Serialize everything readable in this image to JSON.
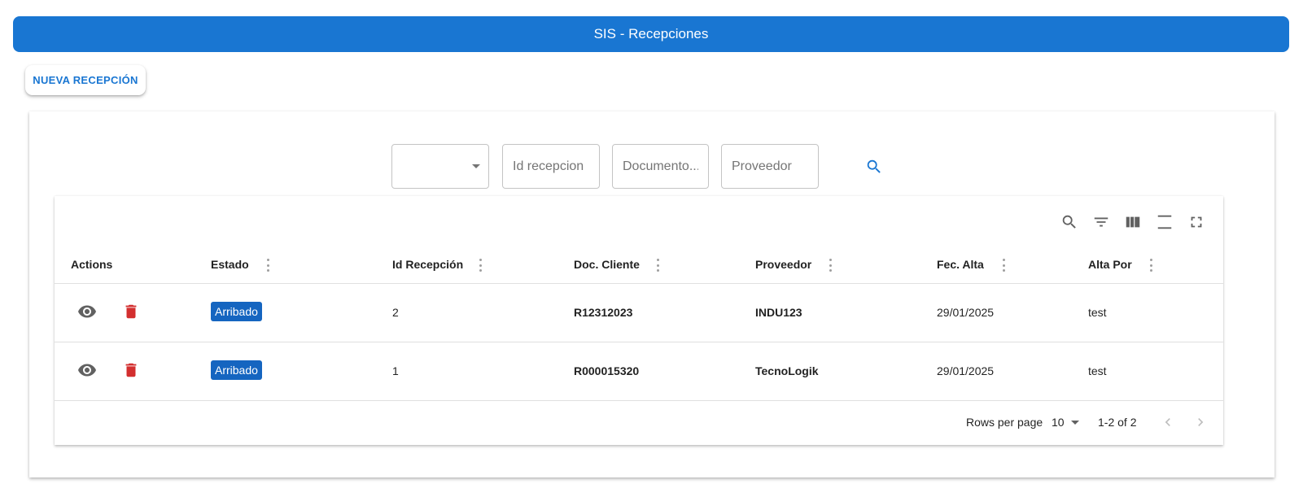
{
  "app": {
    "title": "SIS - Recepciones",
    "accent": "#1976d2"
  },
  "actions": {
    "new_label": "NUEVA RECEPCIÓN"
  },
  "filters": {
    "estado_value": "",
    "id_placeholder": "Id recepcion",
    "doc_placeholder": "Documento...",
    "proveedor_placeholder": "Proveedor",
    "search_icon": "search-icon"
  },
  "toolbar": {
    "icons": [
      "search-icon",
      "filter-list-icon",
      "view-column-icon",
      "density-icon",
      "fullscreen-icon"
    ]
  },
  "table": {
    "columns": [
      "Actions",
      "Estado",
      "Id Recepción",
      "Doc. Cliente",
      "Proveedor",
      "Fec. Alta",
      "Alta Por"
    ],
    "rows": [
      {
        "estado": "Arribado",
        "id": "2",
        "doc_cliente": "R12312023",
        "proveedor": "INDU123",
        "fec_alta": "29/01/2025",
        "alta_por": "test"
      },
      {
        "estado": "Arribado",
        "id": "1",
        "doc_cliente": "R000015320",
        "proveedor": "TecnoLogik",
        "fec_alta": "29/01/2025",
        "alta_por": "test"
      }
    ],
    "status_color": "#1565c0",
    "delete_color": "#d32f2f"
  },
  "pagination": {
    "rows_per_page_label": "Rows per page",
    "rows_per_page_value": "10",
    "range": "1-2 of 2"
  }
}
